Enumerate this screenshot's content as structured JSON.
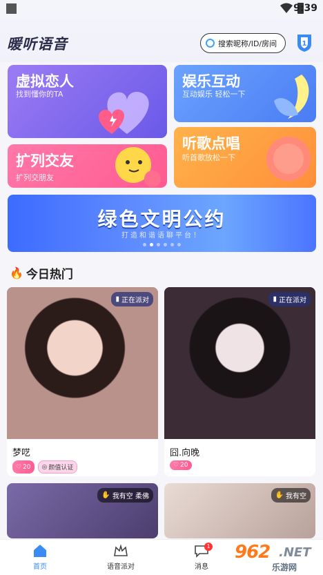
{
  "status_bar": {
    "time": "9:39"
  },
  "header": {
    "app_title": "暖听语音",
    "search_placeholder": "搜索昵称/ID/房间"
  },
  "feature_cards": [
    {
      "title": "虚拟恋人",
      "subtitle": "找到懂你的TA"
    },
    {
      "title": "娱乐互动",
      "subtitle": "互动娱乐 轻松一下"
    },
    {
      "title": "扩列交友",
      "subtitle": "扩列交朋友"
    },
    {
      "title": "听歌点唱",
      "subtitle": "听首歌放松一下"
    }
  ],
  "banner": {
    "title": "绿色文明公约",
    "subtitle": "打造和谐语聊平台！",
    "pages": 6,
    "active_page": 1
  },
  "section": {
    "title": "今日热门"
  },
  "rooms": [
    {
      "name": "梦呓",
      "tag": "正在派对",
      "level": "20",
      "cert": "颜值认证"
    },
    {
      "name": "囧.向晚",
      "tag": "正在派对",
      "level": "20"
    },
    {
      "tag": "我有空 柔佛"
    },
    {
      "tag": "我有空"
    }
  ],
  "nav": {
    "items": [
      "首页",
      "语音派对",
      "消息"
    ],
    "message_badge": "1"
  },
  "watermark": {
    "number": "962",
    "net": ".NET",
    "sub": "乐游网"
  }
}
